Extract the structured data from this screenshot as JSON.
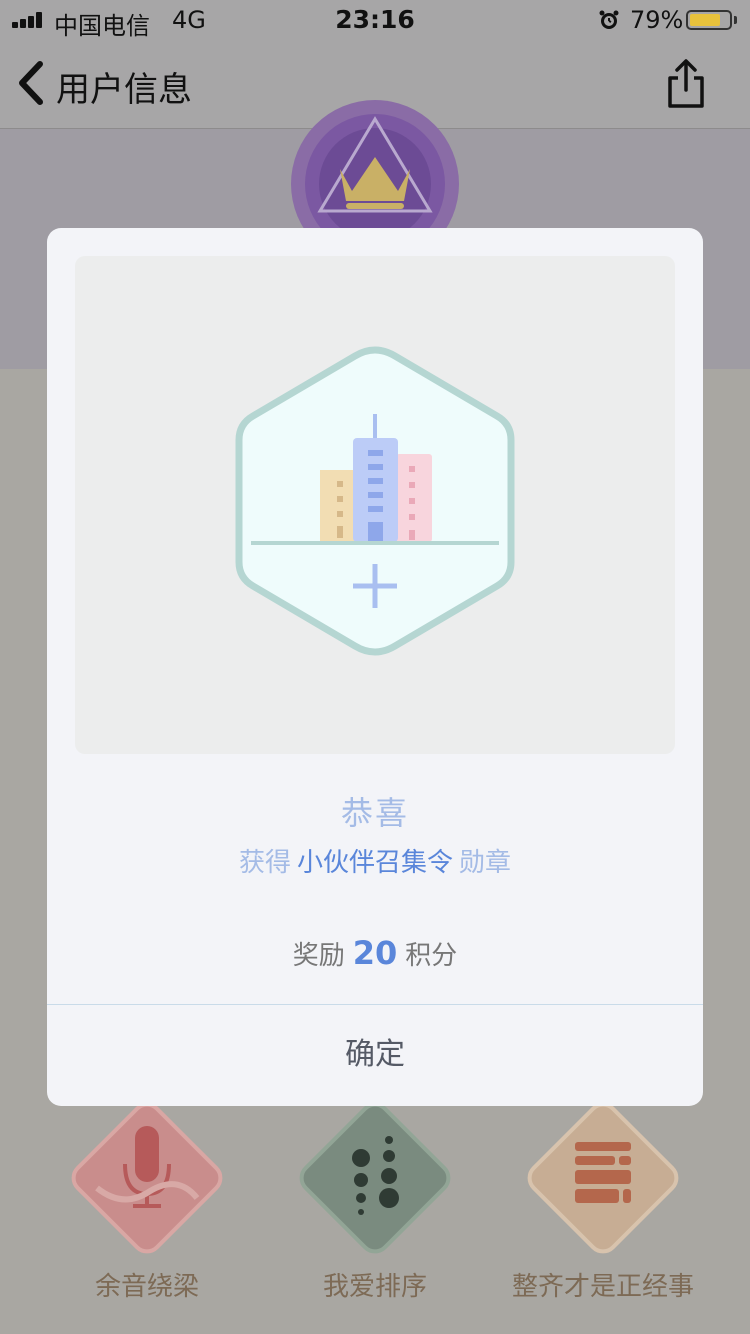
{
  "status_bar": {
    "carrier": "中国电信",
    "network": "4G",
    "time": "23:16",
    "battery_percent": "79%",
    "battery_level": 0.79
  },
  "nav": {
    "title": "用户信息",
    "back_icon": "chevron-left-icon",
    "share_icon": "share-icon"
  },
  "background_badges": [
    {
      "label": "余音绕梁",
      "icon": "microphone-icon",
      "color": "#d9a0a0"
    },
    {
      "label": "我爱排序",
      "icon": "dots-sort-icon",
      "color": "#7f9689"
    },
    {
      "label": "整齐才是正经事",
      "icon": "stacked-bars-icon",
      "color": "#d4b293"
    }
  ],
  "modal": {
    "art_icon": "city-hexagon-badge-icon",
    "title": "恭喜",
    "obtain_prefix": "获得",
    "medal_name": "小伙伴召集令",
    "obtain_suffix": "勋章",
    "reward_prefix": "奖励",
    "reward_points": "20",
    "reward_suffix": "积分",
    "confirm_label": "确定"
  },
  "colors": {
    "accent_blue": "#5a86da",
    "light_blue": "#a4bbe6",
    "hex_border": "#b5d6d2",
    "hex_fill": "#effcfc"
  }
}
